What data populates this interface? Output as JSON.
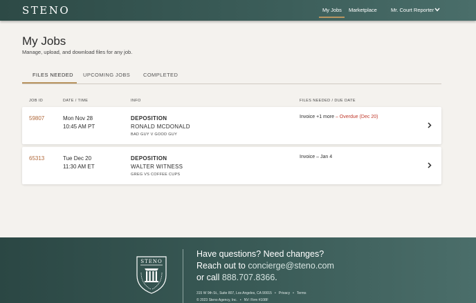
{
  "header": {
    "logo": "STENO",
    "nav": {
      "my_jobs": "My Jobs",
      "marketplace": "Marketplace",
      "user": "Mr. Court Reporter"
    }
  },
  "page": {
    "title": "My Jobs",
    "subtitle": "Manage, upload, and download files for any job."
  },
  "tabs": [
    {
      "label": "FILES NEEDED",
      "active": true
    },
    {
      "label": "UPCOMING JOBS",
      "active": false
    },
    {
      "label": "COMPLETED",
      "active": false
    }
  ],
  "table": {
    "headers": {
      "job_id": "JOB ID",
      "date_time": "DATE / TIME",
      "info": "INFO",
      "files": "FILES NEEDED / DUE DATE"
    },
    "rows": [
      {
        "job_id": "59807",
        "date": "Mon Nov 28",
        "time": "10:45 AM PT",
        "type": "DEPOSITION",
        "name": "RONALD MCDONALD",
        "case": "BAD GUY V GOOD GUY",
        "files": "Invoice +1 more",
        "separator": " – ",
        "due": "Overdue (Dec 20)",
        "overdue": true
      },
      {
        "job_id": "65313",
        "date": "Tue Dec 20",
        "time": "11:30 AM ET",
        "type": "DEPOSITION",
        "name": "WALTER WITNESS",
        "case": "GREG VS COFFEE CUPS",
        "files": "Invoice",
        "separator": " – ",
        "due": "Jan 4",
        "overdue": false
      }
    ]
  },
  "footer": {
    "crest_text": "STENO",
    "question": "Have questions? Need changes?",
    "reach_prefix": "Reach out to ",
    "email": "concierge@steno.com",
    "call_prefix": "or call ",
    "phone": "888.707.8366",
    "call_suffix": ".",
    "address": "315 W 9th St., Suite 807, Los Angeles, CA 90015",
    "privacy": "Privacy",
    "terms": "Terms",
    "copyright": "© 2023 Steno Agency, Inc.",
    "firm": "NV: Firm #108F",
    "bullet": "•"
  },
  "colors": {
    "brand_teal": "#3c5e5a",
    "accent_gold": "#b99560",
    "job_id": "#b0683a",
    "overdue": "#c0392b"
  }
}
